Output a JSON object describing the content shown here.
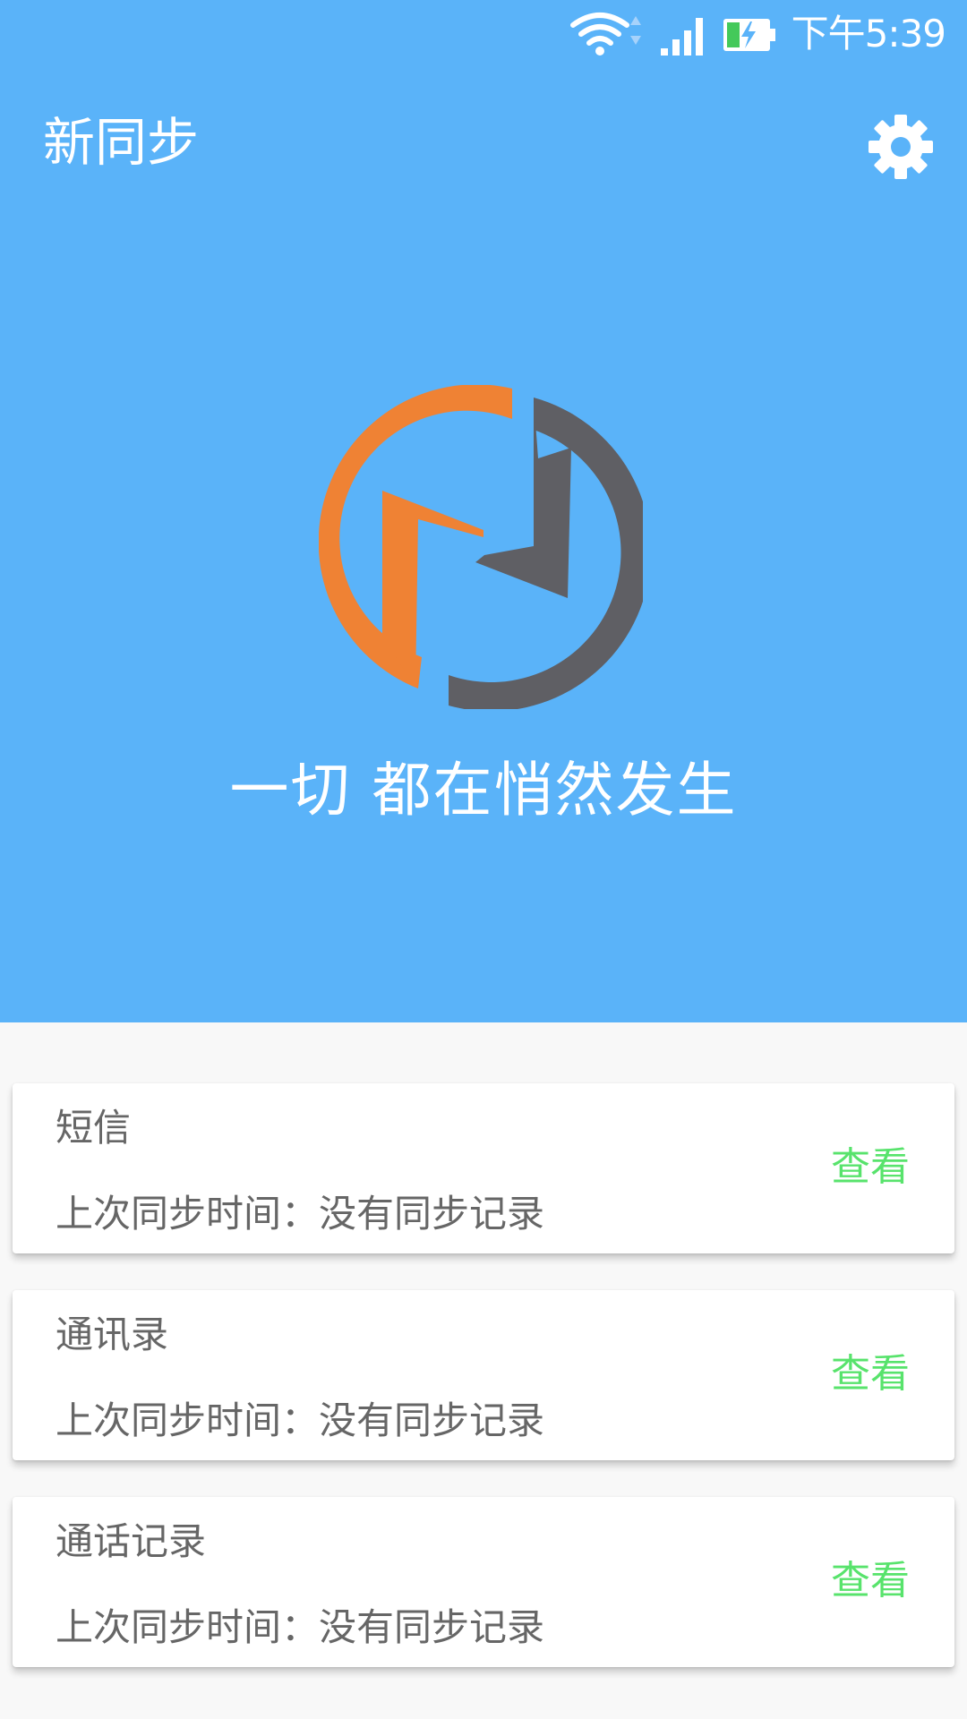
{
  "status_bar": {
    "time": "下午5:39",
    "icons": [
      "wifi-icon",
      "data-arrows-icon",
      "cell-signal-icon",
      "battery-charging-icon"
    ]
  },
  "app_bar": {
    "title": "新同步",
    "settings_icon": "gear-icon"
  },
  "hero": {
    "logo": "sync-logo",
    "tagline": "一切 都在悄然发生"
  },
  "colors": {
    "primary": "#5ab3f9",
    "logo_orange": "#ef8234",
    "logo_gray": "#5f5f64",
    "link_green": "#58e36c",
    "card_text": "#666666",
    "background": "#f8f8f8"
  },
  "sync_items": [
    {
      "title": "短信",
      "status": "上次同步时间：没有同步记录",
      "action": "查看"
    },
    {
      "title": "通讯录",
      "status": "上次同步时间：没有同步记录",
      "action": "查看"
    },
    {
      "title": "通话记录",
      "status": "上次同步时间：没有同步记录",
      "action": "查看"
    }
  ]
}
